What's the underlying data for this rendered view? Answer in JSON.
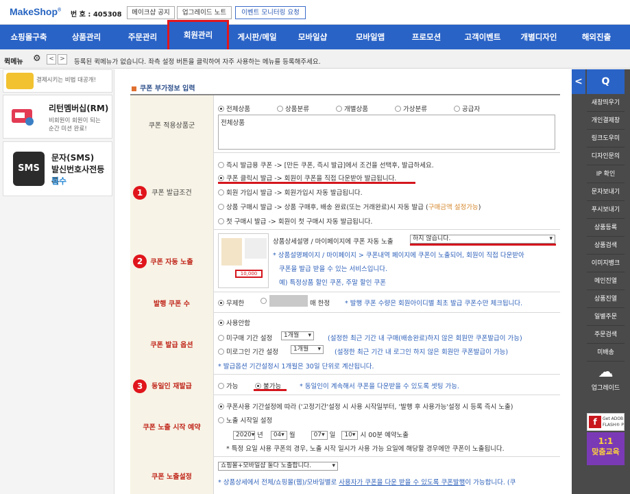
{
  "top": {
    "logo": "MakeShop",
    "shop_number": "번 호 : 405308",
    "buttons": [
      "메이크샵 공지",
      "업그레이드 노트",
      "이벤트 모니터링 요청"
    ]
  },
  "nav": {
    "items": [
      "쇼핑몰구축",
      "상품관리",
      "주문관리",
      "회원관리",
      "게시판/메일",
      "모바일샵",
      "모바일앱",
      "프로모션",
      "고객이벤트",
      "개별디자인",
      "해외진출"
    ],
    "active": "회원관리"
  },
  "quick": {
    "label": "퀵메뉴",
    "message": "등록된 퀵메뉴가 없습니다. 좌측 설정 버튼을 클릭하여 자주 사용하는 메뉴를 등록해주세요."
  },
  "left": {
    "top_banner_text": "결제시키는 비법 대공개!",
    "rm_title": "리턴멤버십(RM)",
    "rm_desc1": "비회원이 회원이 되는",
    "rm_desc2": "순간 미션 완료!",
    "sms_title1": "문자(SMS)",
    "sms_title2": "발신번호사전등록",
    "sms_title3": "필수",
    "sms_icon": "SMS"
  },
  "main": {
    "section_title": "쿠폰 부가정보 입력",
    "target": {
      "label": "쿠폰 적용상품군",
      "options": [
        "전체상품",
        "상품분류",
        "개별상품",
        "가상분류",
        "공급자"
      ],
      "textarea": "전체상품"
    },
    "issue": {
      "label": "쿠폰 발급조건",
      "num": "1",
      "options": [
        "즉시 발급용 쿠폰 -> [만든 쿠폰, 즉시 발급]에서 조건을 선택후, 발급하세요.",
        "쿠폰 클릭시 발급 -> 회원이 쿠폰을 직접 다운받아 발급됩니다.",
        "회원 가입시 발급 -> 회원가입시 자동 발급됩니다.",
        "상품 구매시 발급 -> 상품 구매후, 배송 완료(또는 거래완료)시 자동 발급 (",
        "첫 구매시 발급 -> 회원이 첫 구매시 자동 발급됩니다."
      ],
      "option4_orange": "구매금액 설정가능",
      "option4_end": ")"
    },
    "auto": {
      "label": "쿠폰 자동 노출",
      "num": "2",
      "text": "상품상세설명 / 마이페이지에 쿠폰 자동 노출",
      "select": "하지 않습니다.",
      "note1": "* 상품설명페이지 / 마이페이지 > 쿠폰내역 페이지에 쿠폰이 노출되어, 회원이 직접 다운받아",
      "note2": "쿠폰을 발급 받을 수 있는 서비스입니다.",
      "note3": "예) 특정상품 할인 쿠폰, 주말 할인 쿠폰",
      "thumb_amount": "10,000"
    },
    "count": {
      "label": "발행 쿠폰 수",
      "unlimited": "무제한",
      "limit_suffix": "매 한정",
      "note": "* 발행 쿠폰 수량은 회원아이디별 최초 발급 쿠폰수만 체크됩니다."
    },
    "issue_opt": {
      "label": "쿠폰 발급 옵션",
      "none": "사용안함",
      "opt1": "미구매 기간 설정",
      "opt1_select": "1개월",
      "opt1_note": "(설정한 최근 기간 내 구매(배송완료)하지 않은 회원만 쿠폰발급이 가능)",
      "opt2": "미로그인 기간 설정",
      "opt2_select": "1개월",
      "opt2_note": "(설정한 최근 기간 내 로그인 하지 않은 회원만 쿠폰발급이 가능)",
      "note": "* 발급옵션 기간설정시 1개월은 30일 단위로 계산됩니다."
    },
    "reissue": {
      "label": "동일인 재발급",
      "num": "3",
      "yes": "가능",
      "no": "불가능",
      "note": "* 동일인이 계속해서 쿠폰을 다운받을 수 있도록 셋팅 가능."
    },
    "reserve": {
      "label": "쿠폰 노출 시작 예약",
      "opt1": "쿠폰사용 기간설정에 따라 ('고정기간'설정 시 사용 시작일부터, '발행 후 사용가능'설정 시 등록 즉시 노출)",
      "opt2": "노출 시작일 설정",
      "year": "2020",
      "year_suffix": "년",
      "month": "04",
      "month_suffix": "월",
      "day": "07",
      "day_suffix": "일",
      "hour": "10",
      "hour_suffix": "시 00분 예약노출",
      "note": "* 특정 요일 사용 쿠폰의 경우, 노출 시작 일시가 사용 가능 요일에 해당할 경우에만 쿠폰이 노출됩니다."
    },
    "display": {
      "label": "쿠폰 노출설정",
      "select": "쇼핑몰+모바일샵 둘다 노출합니다.",
      "note_a": "* 상품상세에서 전체/쇼핑몰(웹)/모바일별로 ",
      "note_b": "사용자가 쿠폰을 다운 받을 수 있도록 쿠폰발행",
      "note_c": "이 가능합니다. (쿠"
    }
  },
  "right": {
    "q": "Q",
    "items": [
      "새창띄우기",
      "개인결제창",
      "링크도우미",
      "디자인문의",
      "IP 확인",
      "문자보내기",
      "푸시보내기",
      "상품등록",
      "상품검색",
      "이미지뱅크",
      "메인진열",
      "상품진열",
      "일별주문",
      "주문검색",
      "미배송"
    ],
    "upgrade": "업그레이드",
    "flash_a": "Get ADOB",
    "flash_b": "FLASH® P",
    "promo_a": "1:1",
    "promo_b": "맞춤교육"
  }
}
